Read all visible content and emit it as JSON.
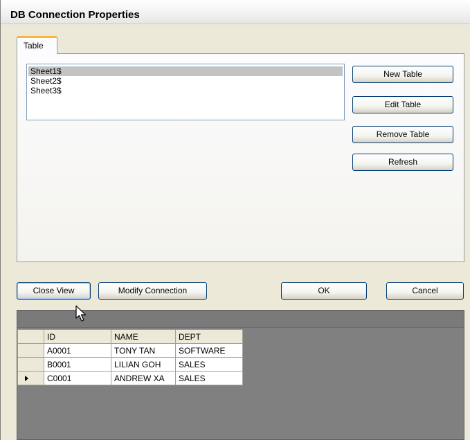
{
  "window": {
    "title": "DB Connection Properties"
  },
  "tabs": [
    {
      "label": "Table"
    }
  ],
  "table_list": {
    "items": [
      "Sheet1$",
      "Sheet2$",
      "Sheet3$"
    ],
    "selected": "Sheet1$"
  },
  "side_buttons": {
    "new_table": "New Table",
    "edit_table": "Edit Table",
    "remove_table": "Remove Table",
    "refresh": "Refresh"
  },
  "bottom_buttons": {
    "close_view": "Close View",
    "modify_connection": "Modify Connection",
    "ok": "OK",
    "cancel": "Cancel"
  },
  "grid": {
    "columns": [
      "ID",
      "NAME",
      "DEPT"
    ],
    "rows": [
      [
        "A0001",
        "TONY TAN",
        "SOFTWARE"
      ],
      [
        "B0001",
        "LILIAN GOH",
        "SALES"
      ],
      [
        "C0001",
        "ANDREW XA",
        "SALES"
      ]
    ],
    "current_row": 2
  }
}
